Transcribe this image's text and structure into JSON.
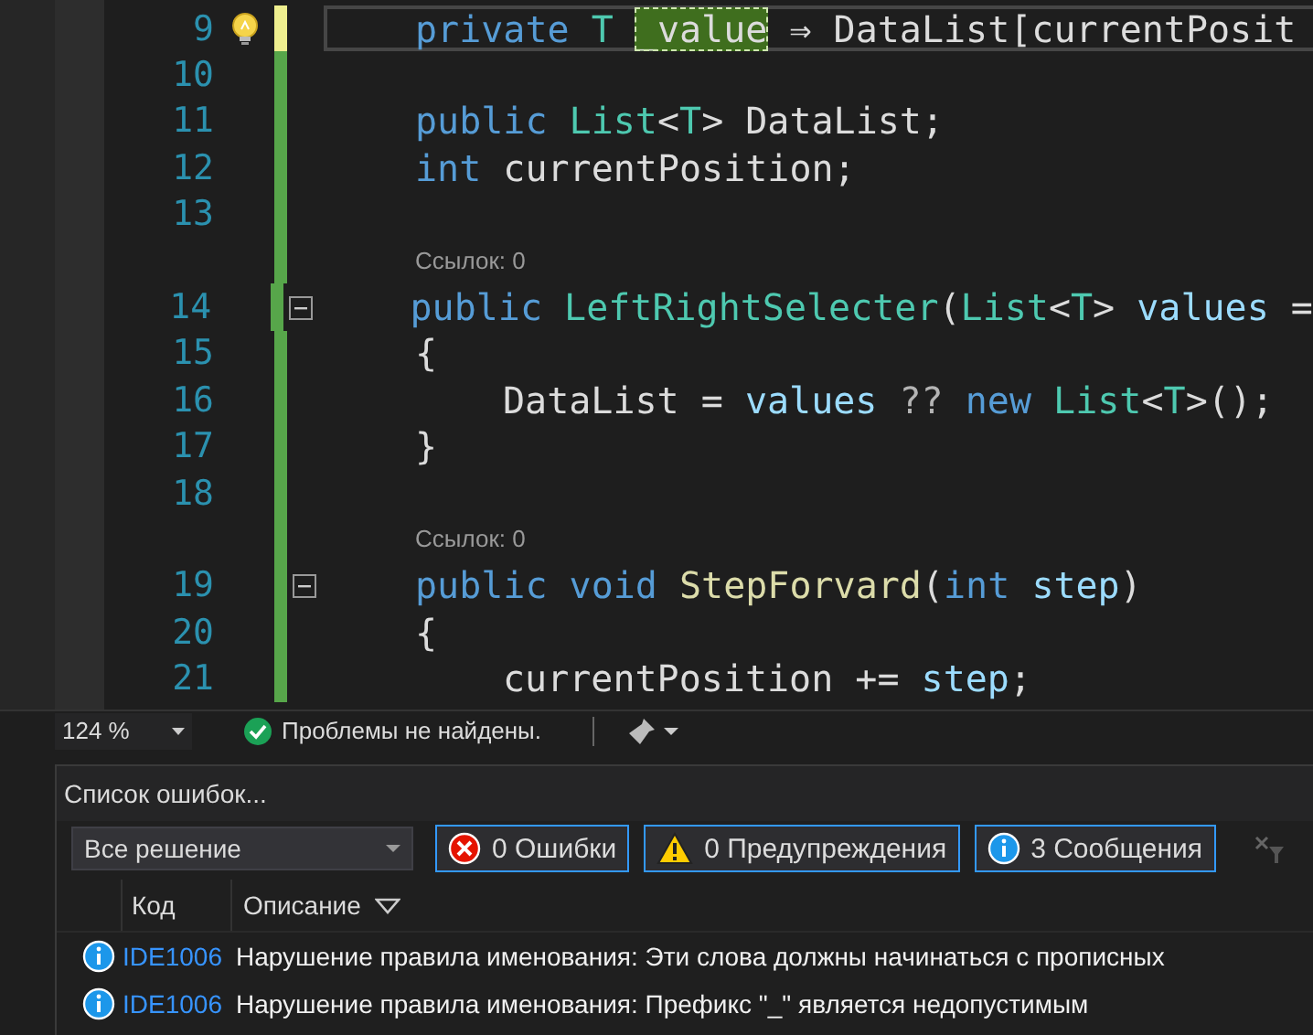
{
  "editor": {
    "lines": [
      {
        "kind": "code",
        "number": "9",
        "saved": false,
        "lightbulb": true,
        "fold": false,
        "current": true,
        "indented": false,
        "tokens": [
          {
            "text": "private ",
            "kind": "keyword"
          },
          {
            "text": "T ",
            "kind": "type"
          },
          {
            "text": "_value",
            "kind": "rename"
          },
          {
            "text": " ⇒ DataList[currentPosit",
            "kind": "plain"
          }
        ]
      },
      {
        "kind": "code",
        "number": "10",
        "saved": true,
        "lightbulb": false,
        "fold": false,
        "current": false
      },
      {
        "kind": "code",
        "number": "11",
        "saved": true,
        "lightbulb": false,
        "fold": false,
        "current": false,
        "indented": false,
        "tokens": [
          {
            "text": "public ",
            "kind": "keyword"
          },
          {
            "text": "List",
            "kind": "type"
          },
          {
            "text": "<",
            "kind": "plain"
          },
          {
            "text": "T",
            "kind": "type"
          },
          {
            "text": "> DataList;",
            "kind": "plain"
          }
        ]
      },
      {
        "kind": "code",
        "number": "12",
        "saved": true,
        "lightbulb": false,
        "fold": false,
        "current": false,
        "indented": false,
        "tokens": [
          {
            "text": "int ",
            "kind": "keyword"
          },
          {
            "text": "currentPosition;",
            "kind": "plain"
          }
        ]
      },
      {
        "kind": "code",
        "number": "13",
        "saved": true,
        "lightbulb": false,
        "fold": false,
        "current": false
      },
      {
        "kind": "codelens",
        "saved": true,
        "text": "Ссылок: 0"
      },
      {
        "kind": "code",
        "number": "14",
        "saved": true,
        "lightbulb": false,
        "fold": true,
        "current": false,
        "indented": false,
        "tokens": [
          {
            "text": "public ",
            "kind": "keyword"
          },
          {
            "text": "LeftRightSelecter",
            "kind": "type"
          },
          {
            "text": "(",
            "kind": "plain"
          },
          {
            "text": "List",
            "kind": "type"
          },
          {
            "text": "<",
            "kind": "plain"
          },
          {
            "text": "T",
            "kind": "type"
          },
          {
            "text": "> ",
            "kind": "plain"
          },
          {
            "text": "values",
            "kind": "param"
          },
          {
            "text": " =",
            "kind": "plain"
          }
        ]
      },
      {
        "kind": "code",
        "number": "15",
        "saved": true,
        "lightbulb": false,
        "fold": false,
        "current": false,
        "indented": false,
        "tokens": [
          {
            "text": "{",
            "kind": "plain"
          }
        ]
      },
      {
        "kind": "code",
        "number": "16",
        "saved": true,
        "lightbulb": false,
        "fold": false,
        "current": false,
        "indented": true,
        "tokens": [
          {
            "text": "DataList = ",
            "kind": "plain"
          },
          {
            "text": "values ",
            "kind": "param"
          },
          {
            "text": "?? ",
            "kind": "op"
          },
          {
            "text": "new ",
            "kind": "keyword"
          },
          {
            "text": "List",
            "kind": "type"
          },
          {
            "text": "<",
            "kind": "plain"
          },
          {
            "text": "T",
            "kind": "type"
          },
          {
            "text": ">();",
            "kind": "plain"
          }
        ]
      },
      {
        "kind": "code",
        "number": "17",
        "saved": true,
        "lightbulb": false,
        "fold": false,
        "current": false,
        "indented": false,
        "tokens": [
          {
            "text": "}",
            "kind": "plain"
          }
        ]
      },
      {
        "kind": "code",
        "number": "18",
        "saved": true,
        "lightbulb": false,
        "fold": false,
        "current": false
      },
      {
        "kind": "codelens",
        "saved": true,
        "text": "Ссылок: 0"
      },
      {
        "kind": "code",
        "number": "19",
        "saved": true,
        "lightbulb": false,
        "fold": true,
        "current": false,
        "indented": false,
        "tokens": [
          {
            "text": "public ",
            "kind": "keyword"
          },
          {
            "text": "void ",
            "kind": "keyword"
          },
          {
            "text": "StepForvard",
            "kind": "method"
          },
          {
            "text": "(",
            "kind": "plain"
          },
          {
            "text": "int ",
            "kind": "keyword"
          },
          {
            "text": "step",
            "kind": "param"
          },
          {
            "text": ")",
            "kind": "plain"
          }
        ]
      },
      {
        "kind": "code",
        "number": "20",
        "saved": true,
        "lightbulb": false,
        "fold": false,
        "current": false,
        "indented": false,
        "tokens": [
          {
            "text": "{",
            "kind": "plain"
          }
        ]
      },
      {
        "kind": "code",
        "number": "21",
        "saved": true,
        "lightbulb": false,
        "fold": false,
        "current": false,
        "indented": true,
        "tokens": [
          {
            "text": "currentPosition += ",
            "kind": "plain"
          },
          {
            "text": "step",
            "kind": "param"
          },
          {
            "text": ";",
            "kind": "plain"
          }
        ]
      }
    ]
  },
  "status_bar": {
    "zoom": "124 %",
    "status": "Проблемы не найдены."
  },
  "error_list": {
    "title": "Список ошибок...",
    "scope": "Все решение",
    "filters": [
      {
        "kind": "error",
        "label": "0 Ошибки",
        "selected": true
      },
      {
        "kind": "warning",
        "label": "0 Предупреждения",
        "selected": true
      },
      {
        "kind": "info",
        "label": "3 Сообщения",
        "selected": true
      }
    ],
    "columns": [
      "Код",
      "Описание"
    ],
    "rows": [
      {
        "kind": "info",
        "code": "IDE1006",
        "description": "Нарушение правила именования: Эти слова должны начинаться с прописных"
      },
      {
        "kind": "info",
        "code": "IDE1006",
        "description": "Нарушение правила именования: Префикс \"_\" является недопустимым"
      }
    ]
  }
}
